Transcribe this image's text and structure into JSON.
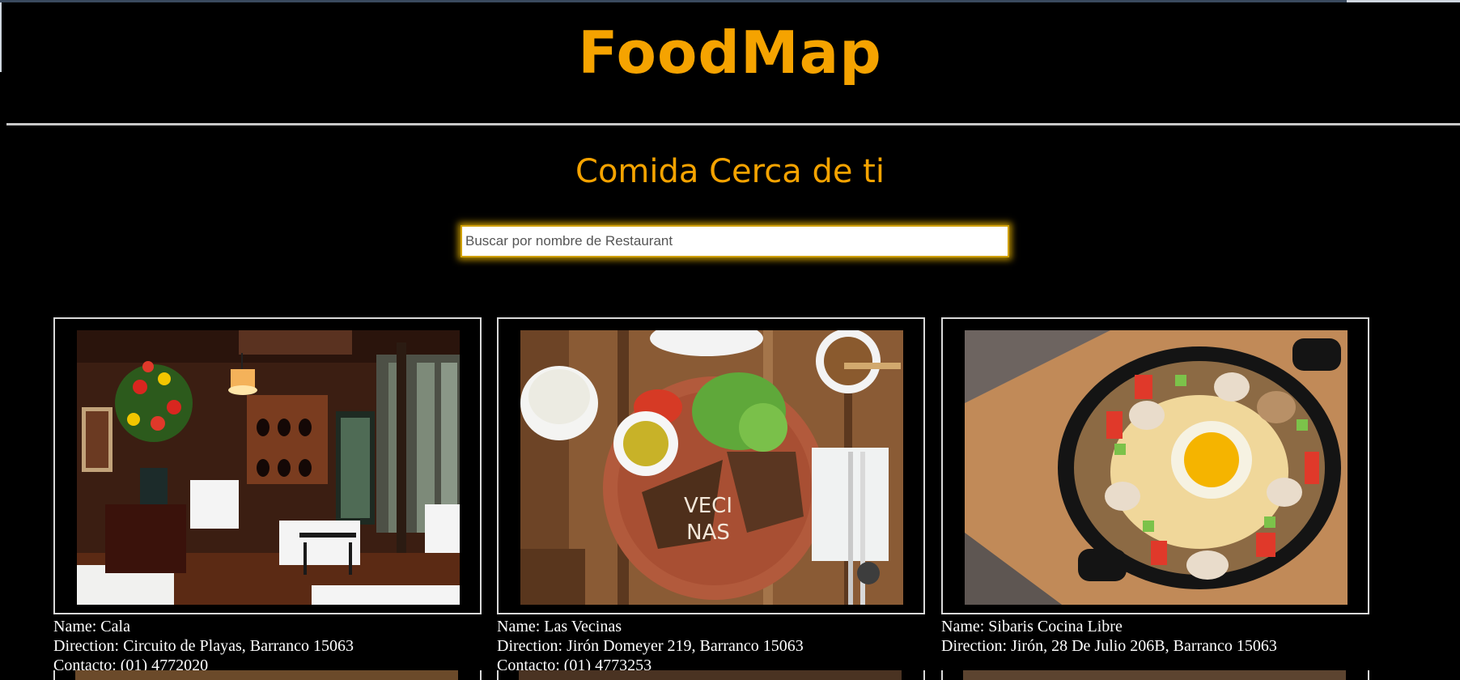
{
  "header": {
    "brand": "FoodMap",
    "subtitle": "Comida Cerca de ti"
  },
  "search": {
    "placeholder": "Buscar por nombre de Restaurant",
    "value": ""
  },
  "restaurants": [
    {
      "name_line": "Name: Cala",
      "direction_line": "Direction: Circuito de Playas, Barranco 15063",
      "contact_line": "Contacto: (01) 4772020",
      "photo_icon": "restaurant-dining-room-photo"
    },
    {
      "name_line": "Name: Las Vecinas",
      "direction_line": "Direction: Jirón Domeyer 219, Barranco 15063",
      "contact_line": "Contacto: (01) 4773253",
      "photo_icon": "sandwich-plate-photo",
      "plate_text_1": "VECI",
      "plate_text_2": "NAS"
    },
    {
      "name_line": "Name: Sibaris Cocina Libre",
      "direction_line": "Direction: Jirón, 28 De Julio 206B, Barranco 15063",
      "contact_line": "",
      "photo_icon": "skillet-egg-dish-photo"
    }
  ],
  "colors": {
    "accent": "#f5a300",
    "background": "#000000",
    "text": "#ffffff"
  }
}
